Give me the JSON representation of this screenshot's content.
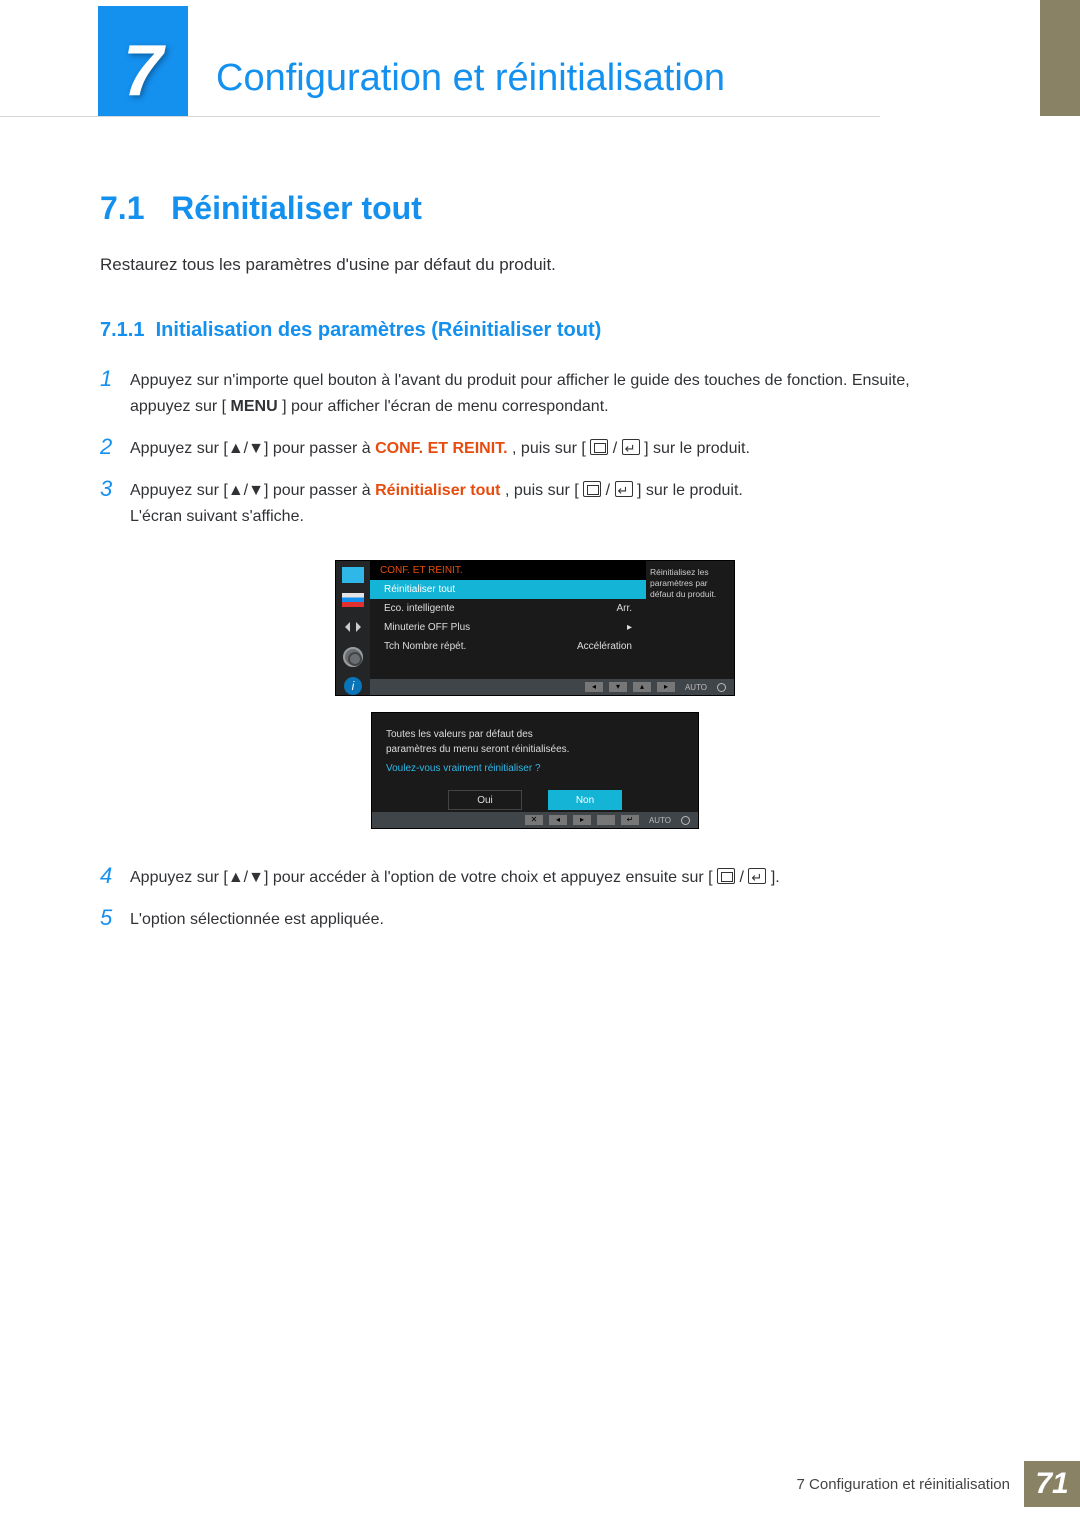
{
  "chapter": {
    "number": "7",
    "title": "Configuration et réinitialisation"
  },
  "section": {
    "number": "7.1",
    "title": "Réinitialiser tout"
  },
  "intro": "Restaurez tous les paramètres d'usine par défaut du produit.",
  "subsection": {
    "number": "7.1.1",
    "title": "Initialisation des paramètres (Réinitialiser tout)"
  },
  "steps": {
    "s1": {
      "num": "1",
      "a": "Appuyez sur n'importe quel bouton à l'avant du produit pour afficher le guide des touches de fonction. Ensuite, appuyez sur [",
      "menu": "MENU",
      "b": "] pour afficher l'écran de menu correspondant."
    },
    "s2": {
      "num": "2",
      "a": "Appuyez sur [▲/▼] pour passer à ",
      "red": "CONF. ET REINIT.",
      "b": ", puis sur [",
      "c": "] sur le produit."
    },
    "s3": {
      "num": "3",
      "a": "Appuyez sur [▲/▼] pour passer à ",
      "red": "Réinitialiser tout",
      "b": ", puis sur [",
      "c": "] sur le produit.",
      "d": "L'écran suivant s'affiche."
    },
    "s4": {
      "num": "4",
      "a": "Appuyez sur [▲/▼] pour accéder à l'option de votre choix et appuyez ensuite sur [",
      "b": "]."
    },
    "s5": {
      "num": "5",
      "a": "L'option sélectionnée est appliquée."
    }
  },
  "osd": {
    "header": "CONF. ET REINIT.",
    "tip": "Réinitialisez les paramètres par défaut du produit.",
    "rows": [
      {
        "label": "Réinitialiser tout",
        "value": ""
      },
      {
        "label": "Eco. intelligente",
        "value": "Arr."
      },
      {
        "label": "Minuterie OFF Plus",
        "value": "▸"
      },
      {
        "label": "Tch Nombre répét.",
        "value": "Accélération"
      }
    ],
    "footer": {
      "btns": [
        "◂",
        "▾",
        "▴",
        "▸"
      ],
      "auto": "AUTO"
    },
    "info_glyph": "i"
  },
  "dialog": {
    "line1": "Toutes les valeurs par défaut des",
    "line2": "paramètres du menu seront réinitialisées.",
    "question": "Voulez-vous vraiment réinitialiser ?",
    "yes": "Oui",
    "no": "Non",
    "footer": {
      "btns": [
        "✕",
        "◂",
        "▸",
        "",
        "↵"
      ],
      "auto": "AUTO"
    }
  },
  "footer": {
    "label": "7 Configuration et réinitialisation",
    "page": "71"
  }
}
